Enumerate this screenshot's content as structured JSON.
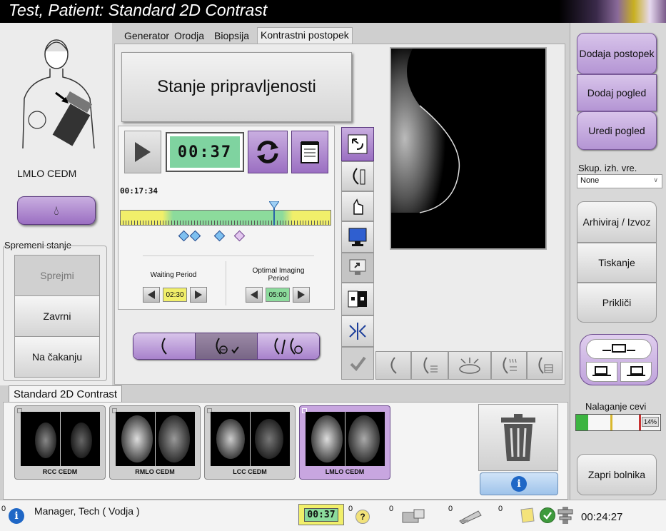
{
  "header": {
    "title": "Test, Patient:  Standard 2D Contrast"
  },
  "tabs": [
    {
      "label": "Generator"
    },
    {
      "label": "Orodja"
    },
    {
      "label": "Biopsija"
    },
    {
      "label": "Kontrastni postopek"
    }
  ],
  "left": {
    "view_label": "LMLO CEDM",
    "change_state_label": "Spremeni stanje",
    "buttons": {
      "accept": "Sprejmi",
      "reject": "Zavrni",
      "pending": "Na čakanju"
    }
  },
  "contrast": {
    "readiness": "Stanje pripravljenosti",
    "timer": "00:37",
    "elapsed": "00:17:34",
    "waiting_label": "Waiting Period",
    "waiting_value": "02:30",
    "optimal_label": "Optimal Imaging Period",
    "optimal_value": "05:00",
    "slider_fraction": 0.73
  },
  "right": {
    "add_procedure": "Dodaja postopek",
    "add_view": "Dodaj pogled",
    "edit_view": "Uredi pogled",
    "output_group_label": "Skup. izh. vre.",
    "output_group_value": "None",
    "archive": "Arhiviraj / Izvoz",
    "print": "Tiskanje",
    "retrieve": "Prikliči",
    "tube_loading_label": "Nalaganje cevi",
    "tube_loading_value": "14%",
    "tube_loading_fraction": 0.14,
    "close_patient": "Zapri bolnika"
  },
  "procedure": {
    "name": "Standard 2D Contrast",
    "thumbnails": [
      {
        "label": "RCC CEDM"
      },
      {
        "label": "RMLO CEDM"
      },
      {
        "label": "LCC CEDM"
      },
      {
        "label": "LMLO CEDM"
      }
    ]
  },
  "status": {
    "alerts_count": "0",
    "user": "Manager, Tech ( Vodja )",
    "timer": "00:37",
    "count1": "0",
    "count2": "0",
    "count3": "0",
    "count4": "0",
    "clock": "00:24:27"
  },
  "colors": {
    "accent": "#b495d4",
    "timer_green": "#7fd3a0",
    "bar_green": "#8cdb9c",
    "bar_yellow": "#f1ef6a"
  }
}
